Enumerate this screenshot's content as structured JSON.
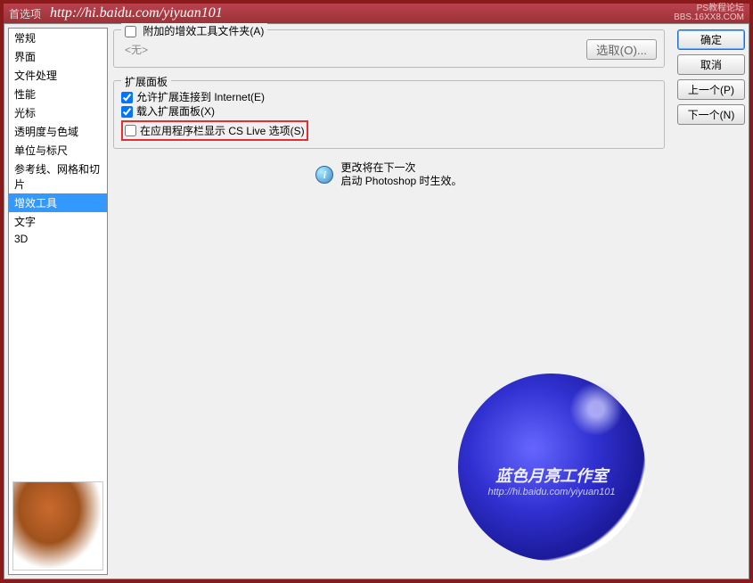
{
  "titlebar": {
    "left": "首选项",
    "url": "http://hi.baidu.com/yiyuan101",
    "right_line1": "PS教程论坛",
    "right_line2": "BBS.16XX8.COM"
  },
  "sidebar": {
    "items": [
      {
        "label": "常规",
        "selected": false
      },
      {
        "label": "界面",
        "selected": false
      },
      {
        "label": "文件处理",
        "selected": false
      },
      {
        "label": "性能",
        "selected": false
      },
      {
        "label": "光标",
        "selected": false
      },
      {
        "label": "透明度与色域",
        "selected": false
      },
      {
        "label": "单位与标尺",
        "selected": false
      },
      {
        "label": "参考线、网格和切片",
        "selected": false
      },
      {
        "label": "增效工具",
        "selected": true
      },
      {
        "label": "文字",
        "selected": false
      },
      {
        "label": "3D",
        "selected": false
      }
    ]
  },
  "group_addon": {
    "legend": "附加的增效工具文件夹(A)",
    "legend_checked": false,
    "placeholder": "<无>",
    "select_btn": "选取(O)..."
  },
  "group_ext": {
    "legend": "扩展面板",
    "opt1": {
      "label": "允许扩展连接到 Internet(E)",
      "checked": true
    },
    "opt2": {
      "label": "载入扩展面板(X)",
      "checked": true
    },
    "opt3": {
      "label": "在应用程序栏显示 CS Live 选项(S)",
      "checked": false
    }
  },
  "info": {
    "line1": "更改将在下一次",
    "line2": "启动 Photoshop 时生效。"
  },
  "buttons": {
    "ok": "确定",
    "cancel": "取消",
    "prev": "上一个(P)",
    "next": "下一个(N)"
  },
  "watermark": {
    "text1": "蓝色月亮工作室",
    "text2": "http://hi.baidu.com/yiyuan101"
  }
}
